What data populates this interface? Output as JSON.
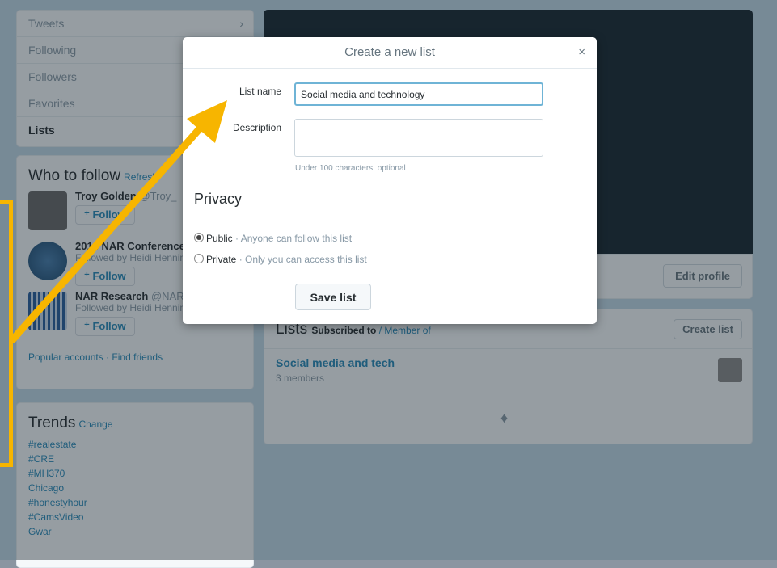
{
  "sidebar": {
    "nav": [
      {
        "label": "Tweets"
      },
      {
        "label": "Following"
      },
      {
        "label": "Followers"
      },
      {
        "label": "Favorites"
      },
      {
        "label": "Lists"
      }
    ],
    "who_to_follow": {
      "title": "Who to follow",
      "refresh": "Refresh",
      "items": [
        {
          "name": "Troy Golden",
          "handle": "@Troy_",
          "byline": "",
          "follow": "Follow"
        },
        {
          "name": "2014 NAR Conference",
          "handle": "",
          "byline": "Followed by Heidi Henning",
          "follow": "Follow"
        },
        {
          "name": "NAR Research",
          "handle": "@NAR",
          "byline": "Followed by Heidi Henning a...",
          "follow": "Follow"
        }
      ],
      "popular": "Popular accounts",
      "find_friends": "Find friends"
    },
    "trends": {
      "title": "Trends",
      "change": "Change",
      "items": [
        "#realestate",
        "#CRE",
        "#MH370",
        "Chicago",
        "#honestyhour",
        "#CamsVideo",
        "Gwar"
      ]
    }
  },
  "profile": {
    "edit_profile": "Edit profile",
    "lists": {
      "title": "Lists",
      "subscribed_to": "Subscribed to",
      "member_of": "Member of",
      "create_list": "Create list",
      "items": [
        {
          "name": "Social media and tech",
          "members": "3 members"
        }
      ]
    }
  },
  "modal": {
    "title": "Create a new list",
    "close_symbol": "×",
    "list_name_label": "List name",
    "list_name_value": "Social media and technology",
    "description_label": "Description",
    "description_value": "",
    "description_hint": "Under 100 characters, optional",
    "privacy_title": "Privacy",
    "public_label": "Public",
    "public_desc": " · Anyone can follow this list",
    "private_label": "Private",
    "private_desc": " · Only you can access this list",
    "selected_privacy": "public",
    "save_label": "Save list"
  },
  "annotation": {
    "color": "#f7b500"
  }
}
